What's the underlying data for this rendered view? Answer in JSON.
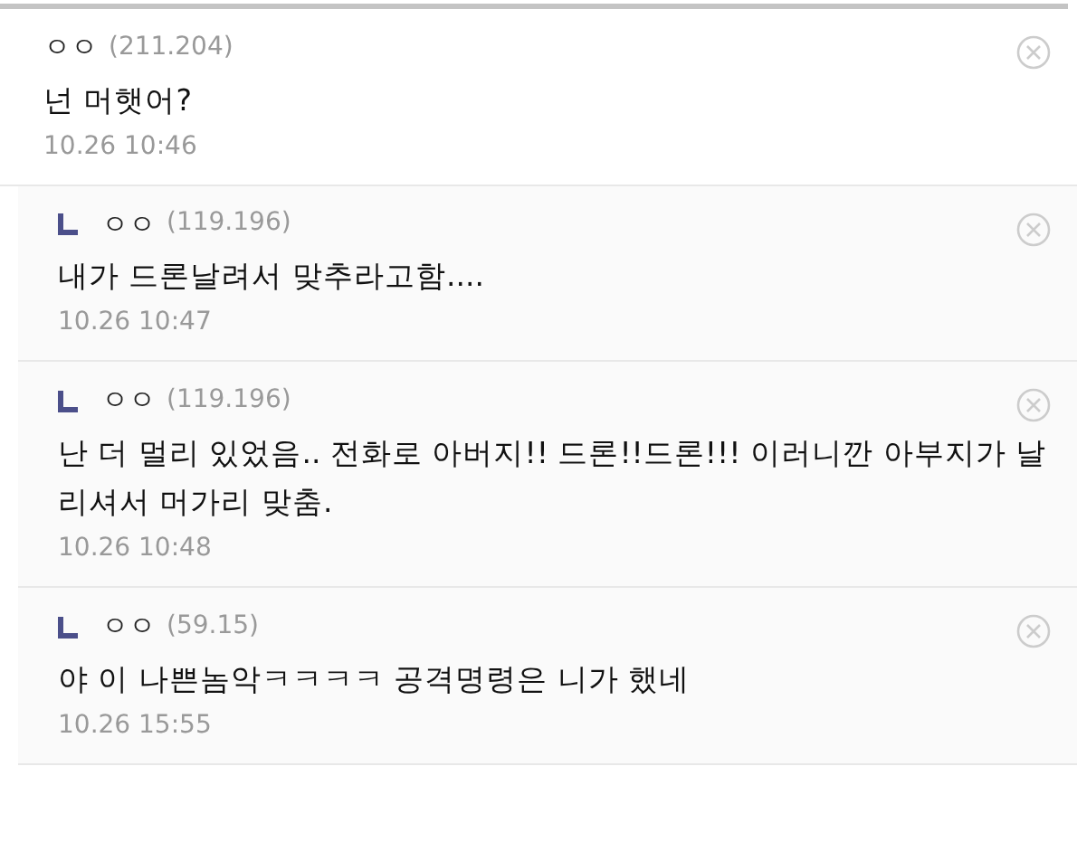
{
  "comments": [
    {
      "author": "ㅇㅇ",
      "ip": "(211.204)",
      "text": "넌 머햇어?",
      "time": "10.26 10:46",
      "reply": false
    },
    {
      "author": "ㅇㅇ",
      "ip": "(119.196)",
      "text": "내가 드론날려서 맞추라고함....",
      "time": "10.26 10:47",
      "reply": true
    },
    {
      "author": "ㅇㅇ",
      "ip": "(119.196)",
      "text": "난 더 멀리 있었음.. 전화로 아버지!! 드론!!드론!!! 이러니깐 아부지가 날리셔서 머가리 맞춤.",
      "time": "10.26 10:48",
      "reply": true
    },
    {
      "author": "ㅇㅇ",
      "ip": "(59.15)",
      "text": "야 이 나쁜놈악ㅋㅋㅋㅋ 공격명령은 니가 했네",
      "time": "10.26 15:55",
      "reply": true
    }
  ]
}
